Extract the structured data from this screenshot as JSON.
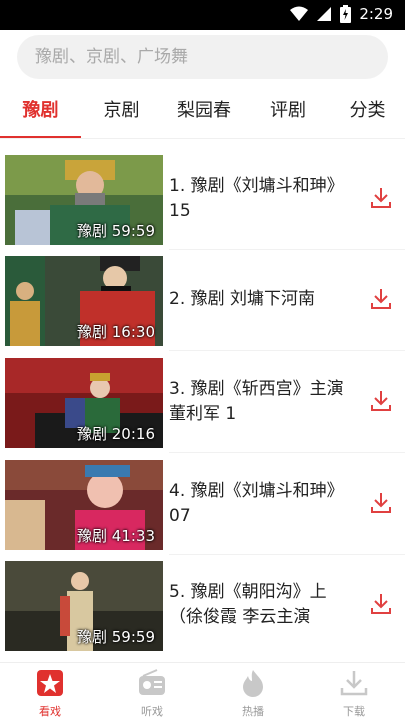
{
  "status": {
    "time": "2:29"
  },
  "search": {
    "placeholder": "豫剧、京剧、广场舞"
  },
  "tabs": [
    {
      "label": "豫剧",
      "active": true
    },
    {
      "label": "京剧"
    },
    {
      "label": "梨园春"
    },
    {
      "label": "评剧"
    },
    {
      "label": "分类"
    }
  ],
  "videos": [
    {
      "title": "1. 豫剧《刘墉斗和珅》15",
      "badge": "豫剧 59:59"
    },
    {
      "title": "2. 豫剧 刘墉下河南",
      "badge": "豫剧 16:30"
    },
    {
      "title": "3. 豫剧《斩西宫》主演 董利军 1",
      "badge": "豫剧 20:16"
    },
    {
      "title": "4. 豫剧《刘墉斗和珅》07",
      "badge": "豫剧 41:33"
    },
    {
      "title": "5. 豫剧《朝阳沟》上（徐俊霞 李云主演",
      "badge": "豫剧 59:59"
    }
  ],
  "bottom_nav": [
    {
      "label": "看戏",
      "icon": "opera-star-icon",
      "active": true
    },
    {
      "label": "听戏",
      "icon": "radio-icon"
    },
    {
      "label": "热播",
      "icon": "flame-icon"
    },
    {
      "label": "下载",
      "icon": "download-icon"
    }
  ],
  "colors": {
    "accent": "#e0312e",
    "download": "#e04040"
  }
}
